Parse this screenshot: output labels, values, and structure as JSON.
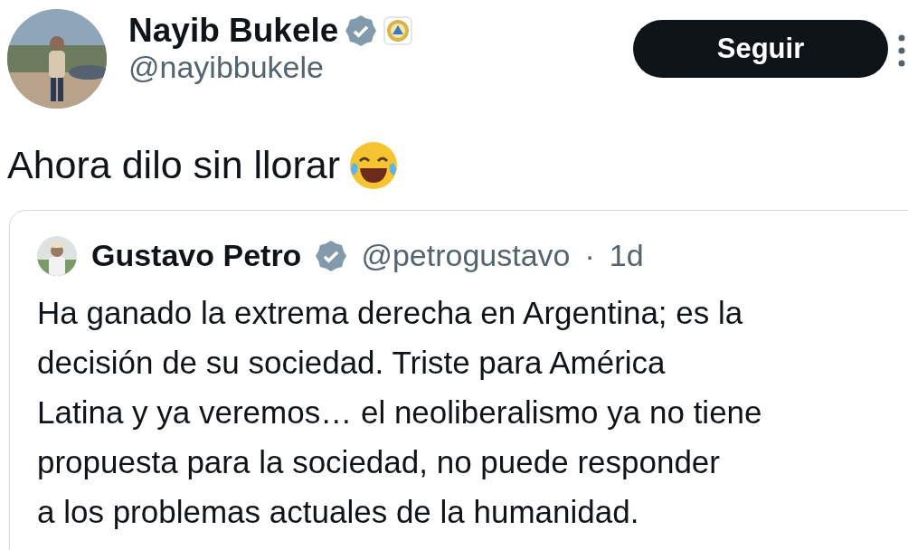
{
  "author": {
    "name": "Nayib Bukele",
    "handle": "@nayibbukele",
    "verified": true,
    "affiliate_badge": true
  },
  "follow_button": {
    "label": "Seguir"
  },
  "tweet": {
    "text": "Ahora dilo sin llorar"
  },
  "quoted_tweet": {
    "author": {
      "name": "Gustavo Petro",
      "handle": "@petrogustavo",
      "verified": true
    },
    "separator": "·",
    "time": "1d",
    "body_lines": [
      "Ha ganado la extrema derecha en Argentina; es la",
      "decisión de su sociedad. Triste para América",
      "Latina y ya veremos… el neoliberalismo ya no tiene",
      "propuesta para la sociedad, no puede responder",
      "a los problemas actuales de la humanidad."
    ]
  }
}
